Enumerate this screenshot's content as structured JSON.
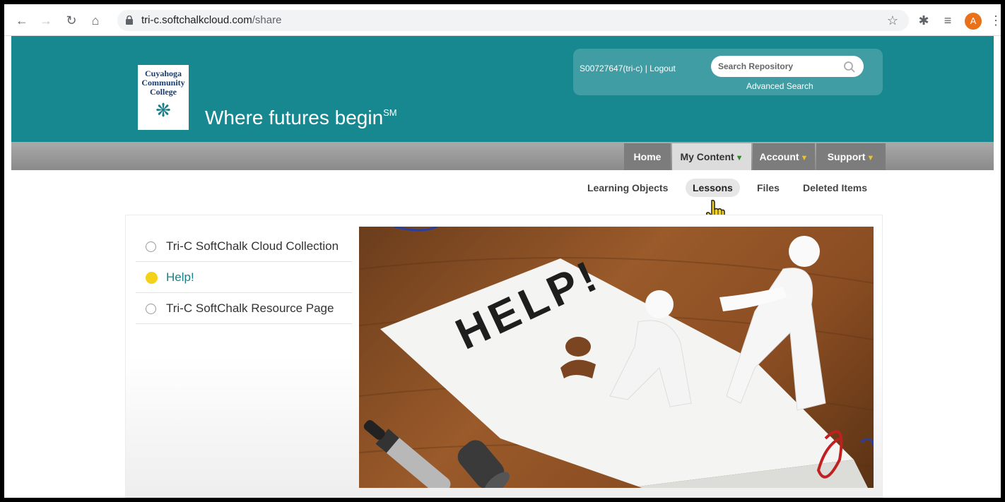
{
  "browser": {
    "url_host": "tri-c.softchalkcloud.com",
    "url_path": "/share",
    "profile_initial": "A"
  },
  "site": {
    "logo_lines": [
      "Cuyahoga",
      "Community",
      "College"
    ],
    "tagline": "Where futures begin",
    "tagline_mark": "SM",
    "user_info": "S00727647(tri-c) | Logout",
    "search_placeholder": "Search Repository",
    "advanced_search": "Advanced Search"
  },
  "nav": {
    "items": [
      {
        "label": "Home",
        "arrow": ""
      },
      {
        "label": "My Content",
        "arrow": "▼"
      },
      {
        "label": "Account",
        "arrow": "▼"
      },
      {
        "label": "Support",
        "arrow": "▼"
      }
    ],
    "sub_items": [
      "Learning Objects",
      "Lessons",
      "Files",
      "Deleted Items"
    ],
    "active_sub": "Lessons"
  },
  "content": {
    "list": [
      {
        "label": "Tri-C SoftChalk Cloud Collection",
        "selected": false
      },
      {
        "label": "Help!",
        "selected": true
      },
      {
        "label": "Tri-C SoftChalk Resource Page",
        "selected": false
      }
    ],
    "hero_text": "HELP!"
  },
  "colors": {
    "header_teal": "#17888f",
    "selected_dot": "#f4d21c",
    "menu_arrow_green": "#2a8a1f",
    "menu_arrow_yellow": "#f1c21b"
  }
}
